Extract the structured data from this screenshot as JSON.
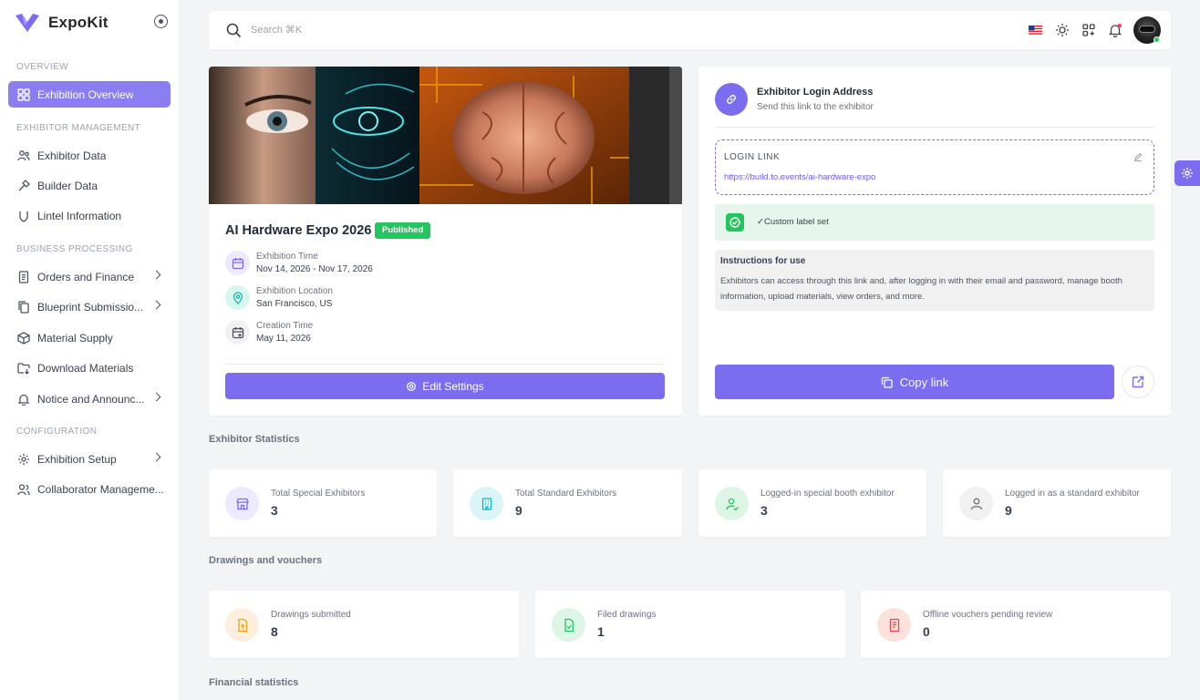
{
  "brand": {
    "name": "ExpoKit"
  },
  "sidebar": {
    "sections": [
      "OVERVIEW",
      "EXHIBITOR MANAGEMENT",
      "BUSINESS PROCESSING",
      "CONFIGURATION"
    ],
    "items": [
      {
        "label": "Exhibition Overview"
      },
      {
        "label": "Exhibitor Data"
      },
      {
        "label": "Builder Data"
      },
      {
        "label": "Lintel Information"
      },
      {
        "label": "Orders and Finance"
      },
      {
        "label": "Blueprint Submissio..."
      },
      {
        "label": "Material Supply"
      },
      {
        "label": "Download Materials"
      },
      {
        "label": "Notice and Announc..."
      },
      {
        "label": "Exhibition Setup"
      },
      {
        "label": "Collaborator Manageme..."
      }
    ]
  },
  "header": {
    "search_placeholder": "Search ⌘K"
  },
  "event": {
    "title": "AI Hardware Expo 2026",
    "status": "Published",
    "time_label": "Exhibition Time",
    "time_value": "Nov 14, 2026 - Nov 17, 2026",
    "location_label": "Exhibition Location",
    "location_value": "San Francisco, US",
    "created_label": "Creation Time",
    "created_value": "May 11, 2026",
    "edit_button": "Edit Settings"
  },
  "login": {
    "title": "Exhibitor Login Address",
    "subtitle": "Send this link to the exhibitor",
    "link_label": "LOGIN LINK",
    "link": "https://build.to.events/ai-hardware-expo",
    "custom_label": "✓Custom label set",
    "instructions_title": "Instructions for use",
    "instructions_body": "Exhibitors can access through this link and, after logging in with their email and password, manage booth information, upload materials, view orders, and more.",
    "copy_button": "Copy link"
  },
  "sections": {
    "exhibitor_statistics": "Exhibitor Statistics",
    "drawings_vouchers": "Drawings and vouchers",
    "financial_statistics": "Financial statistics"
  },
  "exhibitor_stats": [
    {
      "label": "Total Special Exhibitors",
      "value": "3"
    },
    {
      "label": "Total Standard Exhibitors",
      "value": "9"
    },
    {
      "label": "Logged-in special booth exhibitor",
      "value": "3"
    },
    {
      "label": "Logged in as a standard exhibitor",
      "value": "9"
    }
  ],
  "drawing_stats": [
    {
      "label": "Drawings submitted",
      "value": "8"
    },
    {
      "label": "Filed drawings",
      "value": "1"
    },
    {
      "label": "Offline vouchers pending review",
      "value": "0"
    }
  ],
  "colors": {
    "accent": "#7c6cf0",
    "success": "#22c55e"
  }
}
